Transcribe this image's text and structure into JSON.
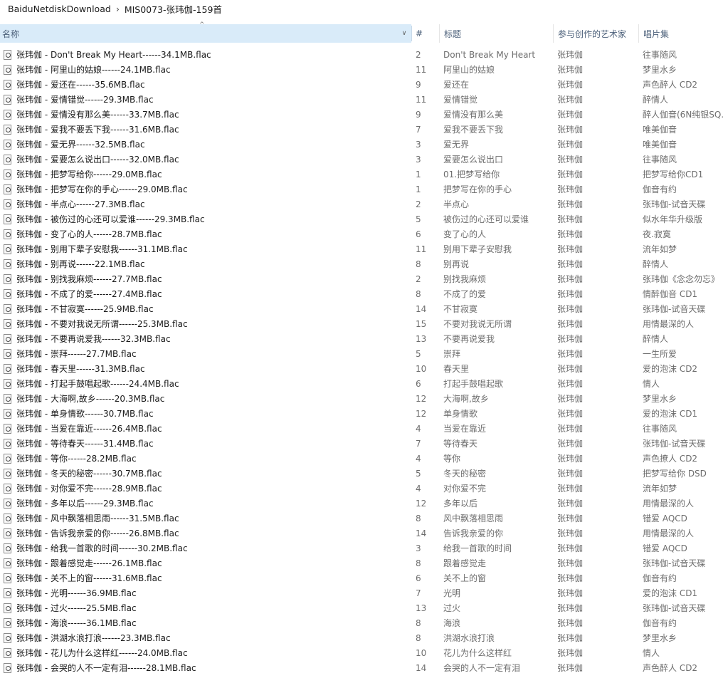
{
  "breadcrumb": {
    "items": [
      "BaiduNetdiskDownload",
      "MIS0073-张玮伽-159首"
    ],
    "separator": "›"
  },
  "columns": {
    "name": "名称",
    "num": "#",
    "title": "标题",
    "artist": "参与创作的艺术家",
    "album": "唱片集"
  },
  "sort_indicator": "^",
  "rows": [
    {
      "name": "张玮伽 - Don't Break My Heart------34.1MB.flac",
      "num": "2",
      "title": "Don't Break My Heart",
      "artist": "张玮伽",
      "album": "往事随风"
    },
    {
      "name": "张玮伽 - 阿里山的姑娘------24.1MB.flac",
      "num": "11",
      "title": "阿里山的姑娘",
      "artist": "张玮伽",
      "album": "梦里水乡"
    },
    {
      "name": "张玮伽 - 爱还在------35.6MB.flac",
      "num": "9",
      "title": "爱还在",
      "artist": "张玮伽",
      "album": "声色醉人 CD2"
    },
    {
      "name": "张玮伽 - 爱情错觉------29.3MB.flac",
      "num": "11",
      "title": "爱情错觉",
      "artist": "张玮伽",
      "album": "醉情人"
    },
    {
      "name": "张玮伽 - 爱情没有那么美------33.7MB.flac",
      "num": "9",
      "title": "爱情没有那么美",
      "artist": "张玮伽",
      "album": "醉人伽音(6N纯银SQ..."
    },
    {
      "name": "张玮伽 - 爱我不要丢下我------31.6MB.flac",
      "num": "7",
      "title": "爱我不要丢下我",
      "artist": "张玮伽",
      "album": "唯美伽音"
    },
    {
      "name": "张玮伽 - 爱无界------32.5MB.flac",
      "num": "3",
      "title": "爱无界",
      "artist": "张玮伽",
      "album": "唯美伽音"
    },
    {
      "name": "张玮伽 - 爱要怎么说出口------32.0MB.flac",
      "num": "3",
      "title": "爱要怎么说出口",
      "artist": "张玮伽",
      "album": "往事随风"
    },
    {
      "name": "张玮伽 - 把梦写给你------29.0MB.flac",
      "num": "1",
      "title": "01.把梦写给你",
      "artist": "张玮伽",
      "album": "把梦写给你CD1"
    },
    {
      "name": "张玮伽 - 把梦写在你的手心------29.0MB.flac",
      "num": "1",
      "title": "把梦写在你的手心",
      "artist": "张玮伽",
      "album": "伽音有约"
    },
    {
      "name": "张玮伽 - 半点心------27.3MB.flac",
      "num": "2",
      "title": "半点心",
      "artist": "张玮伽",
      "album": "张玮伽-试音天碟"
    },
    {
      "name": "张玮伽 - 被伤过的心还可以爱谁------29.3MB.flac",
      "num": "5",
      "title": "被伤过的心还可以爱谁",
      "artist": "张玮伽",
      "album": "似水年华升级版"
    },
    {
      "name": "张玮伽 - 变了心的人------28.7MB.flac",
      "num": "6",
      "title": "变了心的人",
      "artist": "张玮伽",
      "album": "夜.寂寞"
    },
    {
      "name": "张玮伽 - 别用下辈子安慰我------31.1MB.flac",
      "num": "11",
      "title": "别用下辈子安慰我",
      "artist": "张玮伽",
      "album": "流年如梦"
    },
    {
      "name": "张玮伽 - 别再说------22.1MB.flac",
      "num": "8",
      "title": "别再说",
      "artist": "张玮伽",
      "album": "醉情人"
    },
    {
      "name": "张玮伽 - 别找我麻烦------27.7MB.flac",
      "num": "2",
      "title": "别找我麻烦",
      "artist": "张玮伽",
      "album": "张玮伽《念念勿忘》"
    },
    {
      "name": "张玮伽 - 不成了的爱------27.4MB.flac",
      "num": "8",
      "title": "不成了的爱",
      "artist": "张玮伽",
      "album": "情醉伽音 CD1"
    },
    {
      "name": "张玮伽 - 不甘寂寞------25.9MB.flac",
      "num": "14",
      "title": "不甘寂寞",
      "artist": "张玮伽",
      "album": "张玮伽-试音天碟"
    },
    {
      "name": "张玮伽 - 不要对我说无所谓------25.3MB.flac",
      "num": "15",
      "title": "不要对我说无所谓",
      "artist": "张玮伽",
      "album": "用情最深的人"
    },
    {
      "name": "张玮伽 - 不要再说爱我------32.3MB.flac",
      "num": "13",
      "title": "不要再说爱我",
      "artist": "张玮伽",
      "album": "醉情人"
    },
    {
      "name": "张玮伽 - 崇拜------27.7MB.flac",
      "num": "5",
      "title": "崇拜",
      "artist": "张玮伽",
      "album": "一生所爱"
    },
    {
      "name": "张玮伽 - 春天里------31.3MB.flac",
      "num": "10",
      "title": "春天里",
      "artist": "张玮伽",
      "album": "爱的泡沫 CD2"
    },
    {
      "name": "张玮伽 - 打起手鼓唱起歌------24.4MB.flac",
      "num": "6",
      "title": "打起手鼓唱起歌",
      "artist": "张玮伽",
      "album": "情人"
    },
    {
      "name": "张玮伽 - 大海啊,故乡------20.3MB.flac",
      "num": "12",
      "title": "大海啊,故乡",
      "artist": "张玮伽",
      "album": "梦里水乡"
    },
    {
      "name": "张玮伽 - 单身情歌------30.7MB.flac",
      "num": "12",
      "title": "单身情歌",
      "artist": "张玮伽",
      "album": "爱的泡沫 CD1"
    },
    {
      "name": "张玮伽 - 当爱在靠近------26.4MB.flac",
      "num": "4",
      "title": "当爱在靠近",
      "artist": "张玮伽",
      "album": "往事随风"
    },
    {
      "name": "张玮伽 - 等待春天------31.4MB.flac",
      "num": "7",
      "title": "等待春天",
      "artist": "张玮伽",
      "album": "张玮伽-试音天碟"
    },
    {
      "name": "张玮伽 - 等你------28.2MB.flac",
      "num": "4",
      "title": "等你",
      "artist": "张玮伽",
      "album": "声色撩人 CD2"
    },
    {
      "name": "张玮伽 - 冬天的秘密------30.7MB.flac",
      "num": "5",
      "title": "冬天的秘密",
      "artist": "张玮伽",
      "album": "把梦写给你 DSD"
    },
    {
      "name": "张玮伽 - 对你爱不完------28.9MB.flac",
      "num": "4",
      "title": "对你爱不完",
      "artist": "张玮伽",
      "album": "流年如梦"
    },
    {
      "name": "张玮伽 - 多年以后------29.3MB.flac",
      "num": "12",
      "title": "多年以后",
      "artist": "张玮伽",
      "album": "用情最深的人"
    },
    {
      "name": "张玮伽 - 风中飘落相思雨------31.5MB.flac",
      "num": "8",
      "title": "风中飘落相思雨",
      "artist": "张玮伽",
      "album": "错爱 AQCD"
    },
    {
      "name": "张玮伽 - 告诉我亲爱的你------26.8MB.flac",
      "num": "14",
      "title": "告诉我亲爱的你",
      "artist": "张玮伽",
      "album": "用情最深的人"
    },
    {
      "name": "张玮伽 - 给我一首歌的时间------30.2MB.flac",
      "num": "3",
      "title": "给我一首歌的时间",
      "artist": "张玮伽",
      "album": "错爱 AQCD"
    },
    {
      "name": "张玮伽 - 跟着感觉走------26.1MB.flac",
      "num": "8",
      "title": "跟着感觉走",
      "artist": "张玮伽",
      "album": "张玮伽-试音天碟"
    },
    {
      "name": "张玮伽 - 关不上的窗------31.6MB.flac",
      "num": "6",
      "title": "关不上的窗",
      "artist": "张玮伽",
      "album": "伽音有约"
    },
    {
      "name": "张玮伽 - 光明------36.9MB.flac",
      "num": "7",
      "title": "光明",
      "artist": "张玮伽",
      "album": "爱的泡沫 CD1"
    },
    {
      "name": "张玮伽 - 过火------25.5MB.flac",
      "num": "13",
      "title": "过火",
      "artist": "张玮伽",
      "album": "张玮伽-试音天碟"
    },
    {
      "name": "张玮伽 - 海浪------36.1MB.flac",
      "num": "8",
      "title": "海浪",
      "artist": "张玮伽",
      "album": "伽音有约"
    },
    {
      "name": "张玮伽 - 洪湖水浪打浪------23.3MB.flac",
      "num": "8",
      "title": "洪湖水浪打浪",
      "artist": "张玮伽",
      "album": "梦里水乡"
    },
    {
      "name": "张玮伽 - 花儿为什么这样红------24.0MB.flac",
      "num": "10",
      "title": "花儿为什么这样红",
      "artist": "张玮伽",
      "album": "情人"
    },
    {
      "name": "张玮伽 - 会哭的人不一定有泪------28.1MB.flac",
      "num": "14",
      "title": "会哭的人不一定有泪",
      "artist": "张玮伽",
      "album": "声色醉人 CD2"
    }
  ]
}
